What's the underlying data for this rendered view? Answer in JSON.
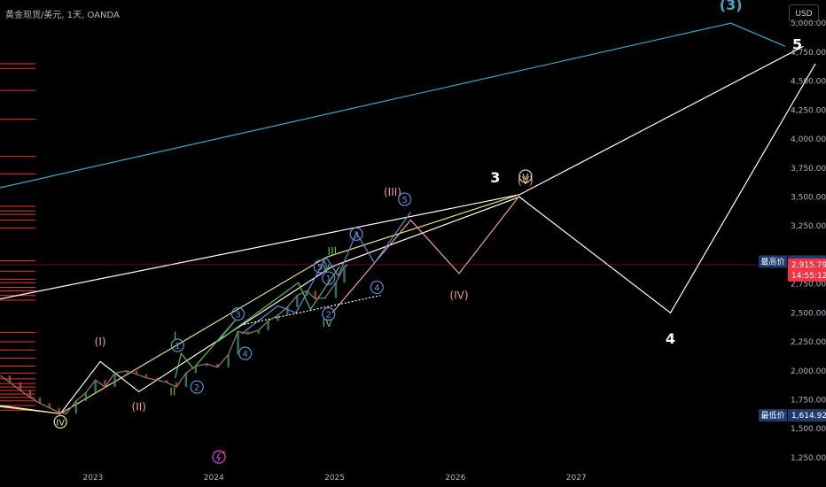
{
  "symbol": {
    "title": "黄金现货/美元, 1天, OANDA"
  },
  "toolbar": {
    "currency": "USD"
  },
  "colors": {
    "bg": "#000000",
    "white": "#ffffff",
    "cyan": "#3aa8c6",
    "yellow": "#e8e27a",
    "pink": "#f29ba5",
    "green": "#5bbf5b",
    "blue": "#5a8fd8",
    "red": "#e53935",
    "high_tag": "#1e3a6e",
    "price_tag": "#f23645"
  },
  "chart_data": {
    "type": "line",
    "x_ticks": [
      "2023",
      "2024",
      "2025",
      "2026",
      "2027"
    ],
    "y_ticks": [
      "5,000.000",
      "4,750.000",
      "4,500.000",
      "4,250.000",
      "4,000.000",
      "3,750.000",
      "3,500.000",
      "3,250.000",
      "2,750.000",
      "2,500.000",
      "2,250.000",
      "2,000.000",
      "1,750.000",
      "1,500.000",
      "1,250.000"
    ],
    "ylim": [
      1150,
      5200
    ],
    "xlim": [
      2022.25,
      2028.75
    ],
    "price_tags": [
      {
        "label": "最高价",
        "value": "2,942.780",
        "price": 2942.78
      },
      {
        "label": "",
        "value": "2,915.795",
        "price": 2915.795,
        "countdown": "14:55:12"
      },
      {
        "label": "最低价",
        "value": "1,614.925",
        "price": 1614.925
      }
    ],
    "price_history": [
      [
        2022.25,
        1960
      ],
      [
        2022.33,
        1900
      ],
      [
        2022.42,
        1830
      ],
      [
        2022.5,
        1770
      ],
      [
        2022.58,
        1720
      ],
      [
        2022.66,
        1680
      ],
      [
        2022.74,
        1640
      ],
      [
        2022.8,
        1630
      ],
      [
        2022.88,
        1740
      ],
      [
        2022.96,
        1810
      ],
      [
        2023.04,
        1920
      ],
      [
        2023.12,
        1860
      ],
      [
        2023.2,
        1980
      ],
      [
        2023.3,
        2000
      ],
      [
        2023.38,
        1970
      ],
      [
        2023.46,
        1940
      ],
      [
        2023.55,
        1920
      ],
      [
        2023.63,
        1900
      ],
      [
        2023.71,
        1860
      ],
      [
        2023.79,
        1980
      ],
      [
        2023.87,
        2040
      ],
      [
        2023.96,
        2060
      ],
      [
        2024.05,
        2030
      ],
      [
        2024.14,
        2140
      ],
      [
        2024.22,
        2340
      ],
      [
        2024.3,
        2320
      ],
      [
        2024.39,
        2350
      ],
      [
        2024.47,
        2430
      ],
      [
        2024.55,
        2480
      ],
      [
        2024.63,
        2550
      ],
      [
        2024.71,
        2650
      ],
      [
        2024.79,
        2690
      ],
      [
        2024.86,
        2620
      ],
      [
        2024.94,
        2630
      ],
      [
        2025.03,
        2760
      ],
      [
        2025.1,
        2900
      ],
      [
        2025.12,
        2916
      ]
    ],
    "series": [
      {
        "points": [
          [
            2022.25,
            2620
          ],
          [
            2026.55,
            3520
          ],
          [
            2028.9,
            4800
          ]
        ]
      },
      {
        "points": [
          [
            2022.25,
            1700
          ],
          [
            2022.75,
            1630
          ],
          [
            2023.08,
            2080
          ],
          [
            2023.4,
            1820
          ],
          [
            2025.0,
            2900
          ],
          [
            2026.55,
            3500
          ],
          [
            2027.8,
            2500
          ],
          [
            2029.0,
            4650
          ]
        ]
      },
      {
        "points": [
          [
            2022.25,
            1690
          ],
          [
            2022.75,
            1630
          ],
          [
            2024.95,
            2980
          ],
          [
            2026.55,
            3520
          ]
        ]
      },
      {
        "points": [
          [
            2022.25,
            3580
          ],
          [
            2028.3,
            5000
          ],
          [
            2028.75,
            4800
          ]
        ]
      },
      {
        "points": [
          [
            2025.0,
            2500
          ],
          [
            2025.65,
            3300
          ],
          [
            2026.05,
            2840
          ],
          [
            2026.55,
            3510
          ]
        ]
      },
      {
        "points": [
          [
            2024.25,
            2320
          ],
          [
            2024.55,
            2560
          ],
          [
            2024.7,
            2500
          ],
          [
            2024.95,
            2980
          ],
          [
            2025.05,
            2820
          ],
          [
            2025.2,
            3190
          ],
          [
            2025.35,
            2930
          ],
          [
            2025.65,
            3370
          ]
        ]
      },
      {
        "points": [
          [
            2023.7,
            1940
          ],
          [
            2023.75,
            2150
          ],
          [
            2023.85,
            2020
          ],
          [
            2024.2,
            2440
          ],
          [
            2024.05,
            2250
          ],
          [
            2024.72,
            2760
          ],
          [
            2024.82,
            2530
          ],
          [
            2025.06,
            2900
          ]
        ]
      },
      {
        "points": [
          [
            2024.27,
            2400
          ],
          [
            2025.4,
            2650
          ]
        ]
      }
    ],
    "wave_labels": [
      {
        "text": "3",
        "x": 2026.35,
        "y": 3680,
        "color": "white",
        "style": "bold"
      },
      {
        "text": "4",
        "x": 2027.8,
        "y": 2290,
        "color": "white",
        "style": "bold"
      },
      {
        "text": "5",
        "x": 2028.85,
        "y": 4830,
        "color": "white",
        "style": "bold"
      },
      {
        "text": "(3)",
        "x": 2028.3,
        "y": 5170,
        "color": "cyan",
        "style": "bold"
      },
      {
        "text": "(I)",
        "x": 2023.08,
        "y": 2250,
        "color": "pink",
        "style": "plain"
      },
      {
        "text": "(II)",
        "x": 2023.4,
        "y": 1690,
        "color": "pink",
        "style": "plain"
      },
      {
        "text": "(III)",
        "x": 2025.5,
        "y": 3540,
        "color": "pink",
        "style": "plain"
      },
      {
        "text": "(IV)",
        "x": 2026.05,
        "y": 2650,
        "color": "pink",
        "style": "plain"
      },
      {
        "text": "(V)",
        "x": 2026.6,
        "y": 3640,
        "color": "pink",
        "style": "plain"
      },
      {
        "text": "I",
        "x": 2023.7,
        "y": 2300,
        "color": "green",
        "style": "plain"
      },
      {
        "text": "II",
        "x": 2023.68,
        "y": 1820,
        "color": "green",
        "style": "plain"
      },
      {
        "text": "III",
        "x": 2025.0,
        "y": 3030,
        "color": "green",
        "style": "plain"
      },
      {
        "text": "IV",
        "x": 2024.96,
        "y": 2410,
        "color": "green",
        "style": "plain"
      },
      {
        "text": "V",
        "x": 2024.95,
        "y": 2880,
        "color": "green",
        "style": "plain"
      },
      {
        "text": "V",
        "x": 2026.6,
        "y": 3680,
        "color": "yellow",
        "style": "circled"
      },
      {
        "text": "IV",
        "x": 2022.75,
        "y": 1560,
        "color": "yellow",
        "style": "circled"
      },
      {
        "text": "1",
        "x": 2023.72,
        "y": 2220,
        "color": "blue",
        "style": "circled"
      },
      {
        "text": "2",
        "x": 2023.88,
        "y": 1860,
        "color": "blue",
        "style": "circled"
      },
      {
        "text": "3",
        "x": 2024.22,
        "y": 2490,
        "color": "blue",
        "style": "circled"
      },
      {
        "text": "4",
        "x": 2024.28,
        "y": 2150,
        "color": "blue",
        "style": "circled"
      },
      {
        "text": "5",
        "x": 2024.9,
        "y": 2900,
        "color": "blue",
        "style": "circled"
      },
      {
        "text": "1",
        "x": 2024.97,
        "y": 2800,
        "color": "blue",
        "style": "circled"
      },
      {
        "text": "2",
        "x": 2024.97,
        "y": 2490,
        "color": "blue",
        "style": "circled"
      },
      {
        "text": "3",
        "x": 2025.2,
        "y": 3180,
        "color": "blue",
        "style": "circled"
      },
      {
        "text": "4",
        "x": 2025.37,
        "y": 2720,
        "color": "blue",
        "style": "circled"
      },
      {
        "text": "5",
        "x": 2025.6,
        "y": 3480,
        "color": "blue",
        "style": "circled"
      }
    ],
    "support_levels": [
      4650,
      4610,
      4420,
      4170,
      3850,
      3700,
      3420,
      3380,
      3350,
      3300,
      3230,
      2950,
      2860,
      2790,
      2760,
      2720,
      2690,
      2650,
      2610,
      2330,
      2250,
      2180,
      2110,
      2040,
      1980,
      1930,
      1890,
      1860,
      1830,
      1800,
      1770,
      1740,
      1700,
      1660
    ]
  }
}
